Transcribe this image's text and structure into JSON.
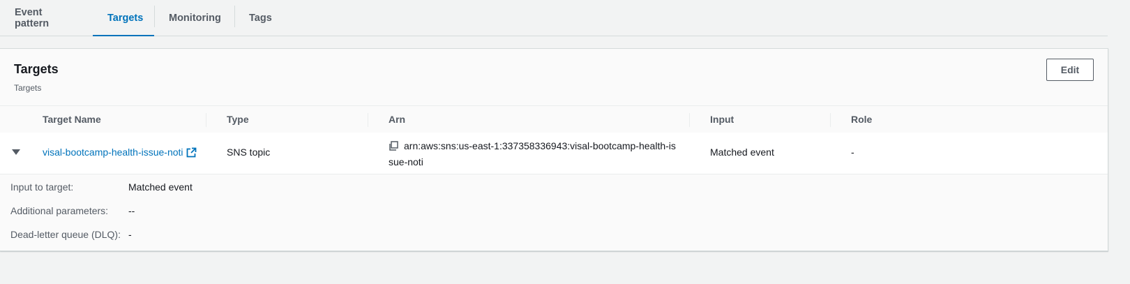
{
  "tabs": [
    {
      "label": "Event pattern",
      "active": false
    },
    {
      "label": "Targets",
      "active": true
    },
    {
      "label": "Monitoring",
      "active": false
    },
    {
      "label": "Tags",
      "active": false
    }
  ],
  "panel": {
    "title": "Targets",
    "description": "Targets",
    "edit_label": "Edit"
  },
  "table": {
    "columns": [
      "Target Name",
      "Type",
      "Arn",
      "Input",
      "Role"
    ],
    "row": {
      "target_name": "visal-bootcamp-health-issue-noti",
      "type": "SNS topic",
      "arn_line1": "arn:aws:sns:us-east-1:337358336943:visal-bootcamp-health-is",
      "arn_line2": "sue-noti",
      "input": "Matched event",
      "role": "-"
    }
  },
  "details": [
    {
      "label": "Input to target:",
      "value": "Matched event"
    },
    {
      "label": "Additional parameters:",
      "value": "--"
    },
    {
      "label": "Dead-letter queue (DLQ):",
      "value": "-"
    }
  ],
  "colors": {
    "accent": "#0073bb",
    "text": "#16191f",
    "muted": "#545b64",
    "background": "#f2f3f3"
  },
  "icons": {
    "external_link": "external-link-icon",
    "copy": "copy-icon",
    "expand": "caret-down-icon"
  }
}
